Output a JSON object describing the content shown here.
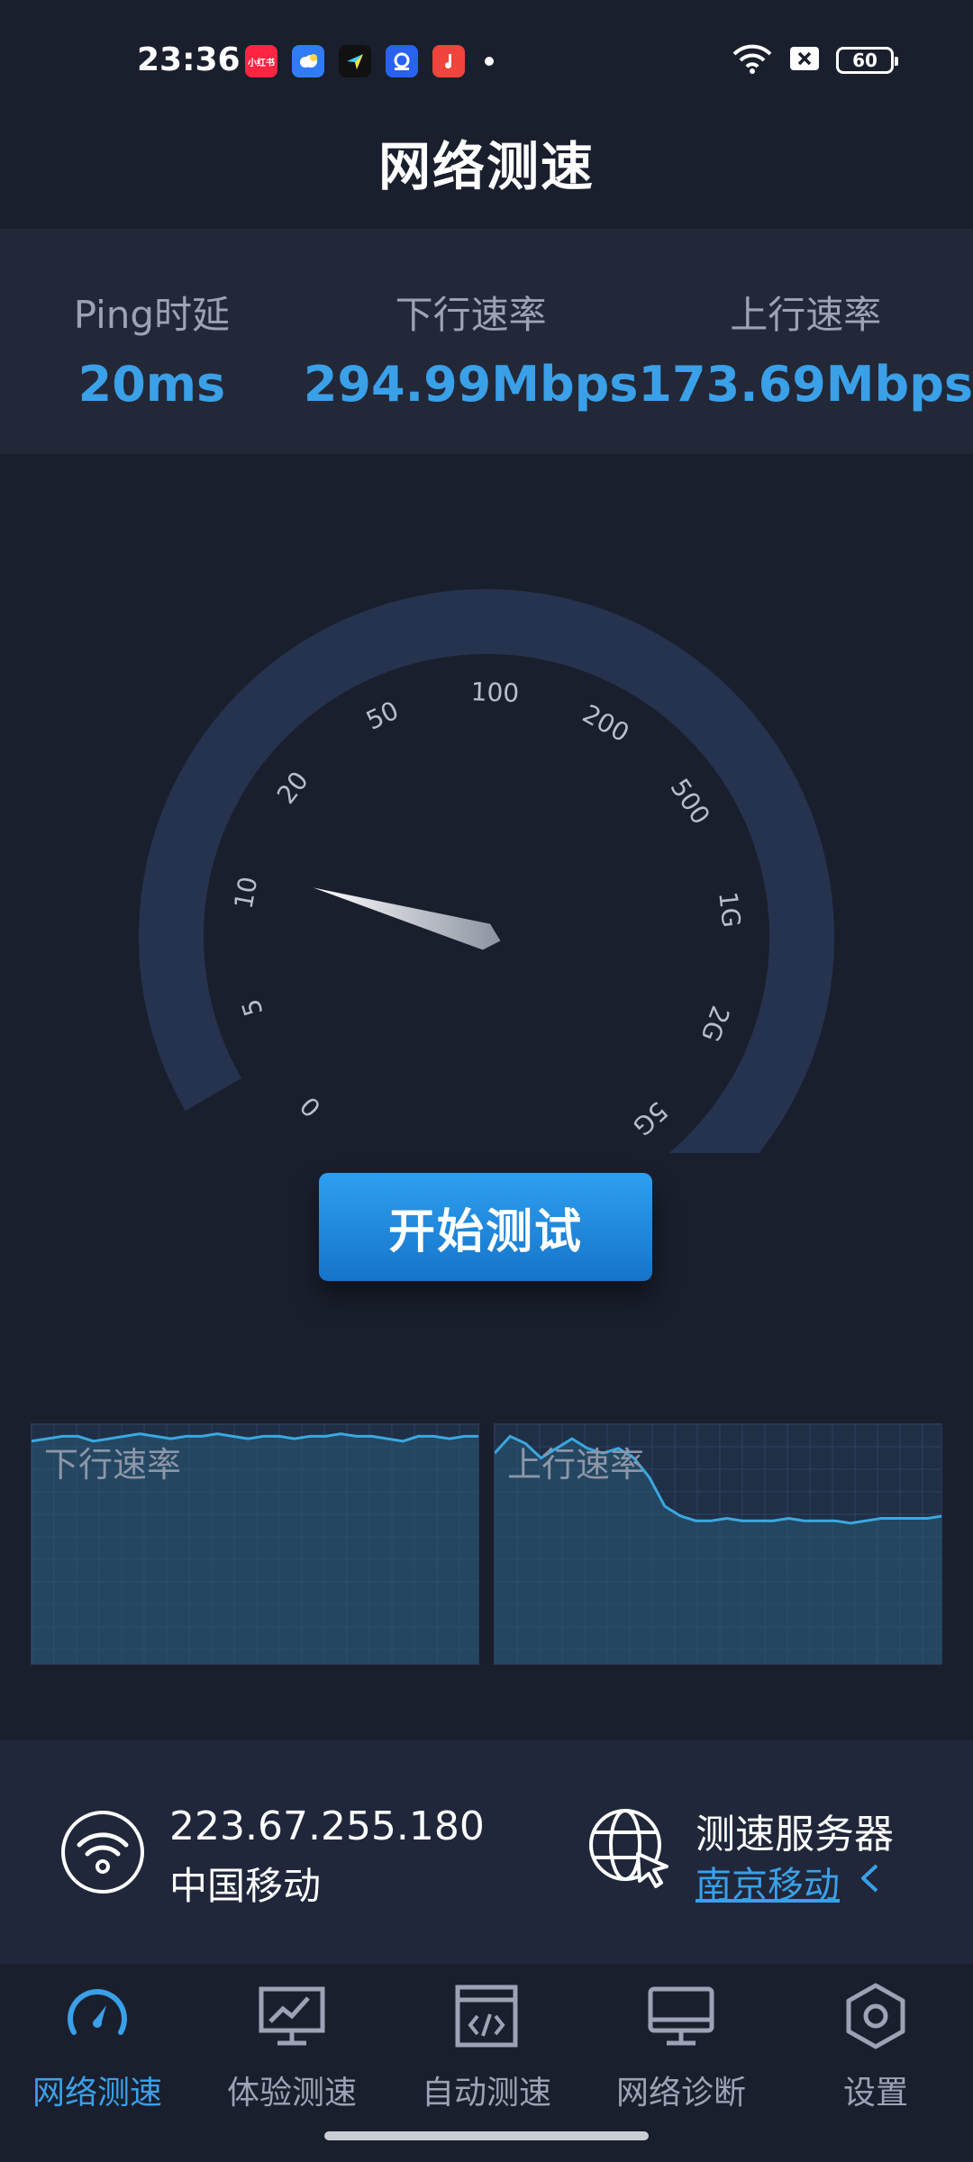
{
  "status_bar": {
    "time": "23:36",
    "app_icons": [
      {
        "name": "xiaohongshu-icon",
        "label": "小红书",
        "color": "#ff2442"
      },
      {
        "name": "weather-icon",
        "label": "",
        "color": "#2f7cf6"
      },
      {
        "name": "navigation-icon",
        "label": "",
        "color": "#111111"
      },
      {
        "name": "app-icon",
        "label": "",
        "color": "#2a62f0"
      },
      {
        "name": "music-icon",
        "label": "",
        "color": "#f0443c"
      }
    ],
    "battery": "60"
  },
  "page_title": "网络测速",
  "stats": {
    "ping": {
      "label": "Ping时延",
      "value": "20ms"
    },
    "download": {
      "label": "下行速率",
      "value": "294.99Mbps"
    },
    "upload": {
      "label": "上行速率",
      "value": "173.69Mbps"
    }
  },
  "gauge": {
    "ticks": [
      "0",
      "5",
      "10",
      "20",
      "50",
      "100",
      "200",
      "500",
      "1G",
      "2G",
      "5G"
    ],
    "needle_fraction": 0.22
  },
  "start_button": "开始测试",
  "mini_charts": {
    "download": {
      "label": "下行速率",
      "values": [
        0.93,
        0.94,
        0.95,
        0.95,
        0.93,
        0.94,
        0.95,
        0.96,
        0.95,
        0.94,
        0.95,
        0.95,
        0.96,
        0.95,
        0.94,
        0.95,
        0.95,
        0.94,
        0.95,
        0.95,
        0.96,
        0.95,
        0.95,
        0.94,
        0.93,
        0.95,
        0.95,
        0.94,
        0.95,
        0.95
      ]
    },
    "upload": {
      "label": "上行速率",
      "values": [
        0.88,
        0.95,
        0.92,
        0.86,
        0.9,
        0.94,
        0.9,
        0.88,
        0.9,
        0.86,
        0.78,
        0.66,
        0.62,
        0.6,
        0.6,
        0.61,
        0.6,
        0.6,
        0.6,
        0.61,
        0.6,
        0.6,
        0.6,
        0.59,
        0.6,
        0.61,
        0.61,
        0.61,
        0.61,
        0.62
      ]
    }
  },
  "network": {
    "ip": "223.67.255.180",
    "isp": "中国移动"
  },
  "server": {
    "title": "测速服务器",
    "name": "南京移动"
  },
  "nav": [
    {
      "label": "网络测速",
      "icon": "speedometer-icon",
      "active": true
    },
    {
      "label": "体验测速",
      "icon": "chart-monitor-icon",
      "active": false
    },
    {
      "label": "自动测速",
      "icon": "code-window-icon",
      "active": false
    },
    {
      "label": "网络诊断",
      "icon": "monitor-icon",
      "active": false
    },
    {
      "label": "设置",
      "icon": "settings-hexagon-icon",
      "active": false
    }
  ],
  "colors": {
    "accent": "#3aa0e8",
    "background": "#1a1f2e",
    "panel": "#222838",
    "gauge_ring": "#26334f"
  }
}
